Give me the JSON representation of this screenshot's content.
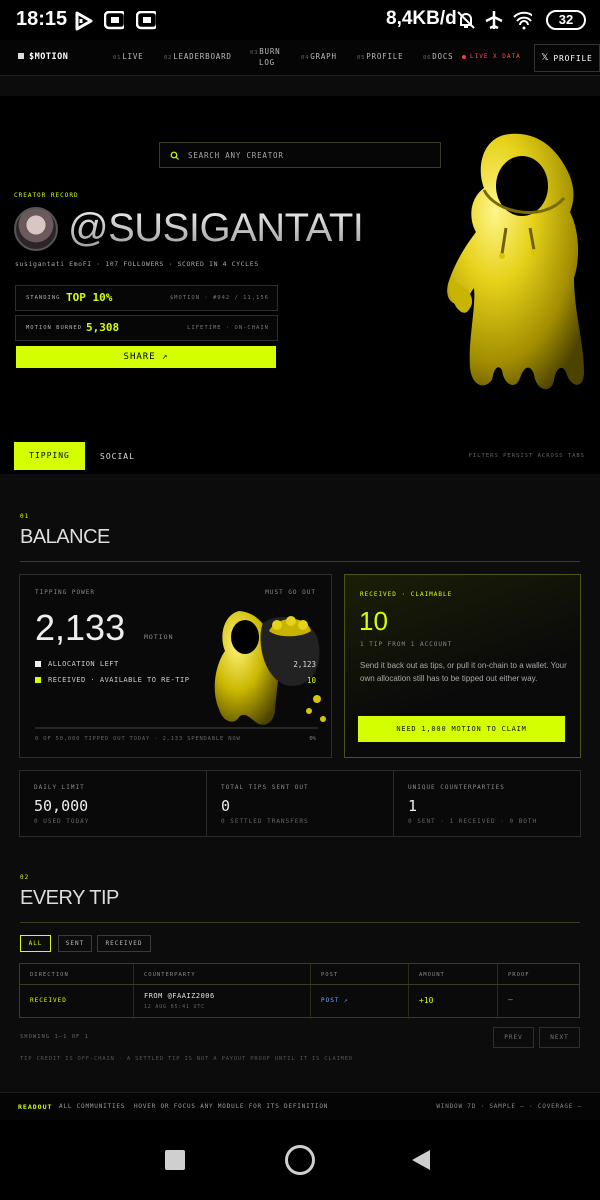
{
  "status_bar": {
    "time": "18:15",
    "net_speed": "8,4KB/d",
    "battery": "32"
  },
  "nav": {
    "brand": "$MOTION",
    "items": [
      {
        "num": "01",
        "label": "LIVE"
      },
      {
        "num": "02",
        "label": "LEADERBOARD"
      },
      {
        "num": "03",
        "label": "BURN",
        "label2": "LOG"
      },
      {
        "num": "04",
        "label": "GRAPH"
      },
      {
        "num": "05",
        "label": "PROFILE"
      },
      {
        "num": "06",
        "label": "DOCS"
      }
    ],
    "live_label": "LIVE X DATA",
    "profile_button": "PROFILE"
  },
  "search": {
    "placeholder": "SEARCH ANY CREATOR"
  },
  "creator": {
    "record_label": "CREATOR RECORD",
    "handle": "@SUSIGANTATI",
    "meta": "susigantati EmoFI · 107 FOLLOWERS · SCORED IN 4 CYCLES",
    "standing_label": "STANDING",
    "standing_value": "TOP 10%",
    "standing_right": "$MOTION · #942 / 11,156",
    "burned_label": "MOTION BURNED",
    "burned_value": "5,308",
    "burned_right": "LIFETIME · ON-CHAIN",
    "share_label": "SHARE ↗"
  },
  "tabs": {
    "active": "TIPPING",
    "other": "SOCIAL",
    "note": "FILTERS PERSIST ACROSS TABS"
  },
  "balance": {
    "num": "01",
    "title": "BALANCE",
    "tipping_power_label": "TIPPING POWER",
    "must_go_out": "MUST GO OUT",
    "power_value": "2,133",
    "power_unit": "MOTION",
    "allocation_label": "ALLOCATION LEFT",
    "allocation_value": "2,123",
    "received_label": "RECEIVED · AVAILABLE TO RE-TIP",
    "received_value": "10",
    "progress_text": "0 OF 50,000 TIPPED OUT TODAY · 2,133 SPENDABLE NOW",
    "progress_pct": "0%",
    "progress_fraction": 0,
    "claim_label": "RECEIVED · CLAIMABLE",
    "claim_value": "10",
    "claim_sub": "1 TIP FROM 1 ACCOUNT",
    "claim_desc": "Send it back out as tips, or pull it on-chain to a wallet. Your own allocation still has to be tipped out either way.",
    "claim_button": "NEED 1,000 MOTION TO CLAIM"
  },
  "metrics": [
    {
      "label": "DAILY LIMIT",
      "value": "50,000",
      "sub": "0 USED TODAY"
    },
    {
      "label": "TOTAL TIPS SENT OUT",
      "value": "0",
      "sub": "0 SETTLED TRANSFERS"
    },
    {
      "label": "UNIQUE COUNTERPARTIES",
      "value": "1",
      "sub": "0 SENT · 1 RECEIVED · 0 BOTH"
    }
  ],
  "tips": {
    "num": "02",
    "title": "EVERY TIP",
    "filters": [
      "ALL",
      "SENT",
      "RECEIVED"
    ],
    "headers": [
      "DIRECTION",
      "COUNTERPARTY",
      "POST",
      "AMOUNT",
      "PROOF"
    ],
    "row": {
      "direction": "RECEIVED",
      "counterparty": "FROM @FAAIZ2006",
      "date": "12 AUG 05:41 UTC",
      "post": "POST ↗",
      "amount": "+10",
      "proof": "—"
    },
    "showing": "SHOWING 1–1 OF 1",
    "prev": "PREV",
    "next": "NEXT",
    "disclaimer": "TIP CREDIT IS OFF-CHAIN · A SETTLED TIP IS NOT A PAYOUT PROOF UNTIL IT IS CLAIMED"
  },
  "readout": {
    "label": "READOUT",
    "text": "ALL COMMUNITIES  HOVER OR FOCUS ANY MODULE FOR ITS DEFINITION",
    "right": "WINDOW 7D · SAMPLE — · COVERAGE —"
  }
}
